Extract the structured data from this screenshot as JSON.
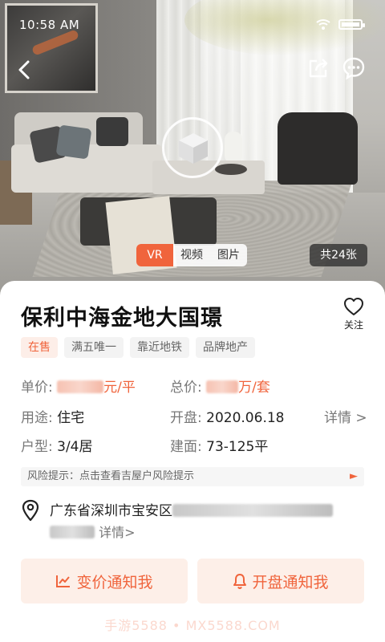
{
  "status_bar": {
    "time": "10:58 AM"
  },
  "media": {
    "tabs": [
      {
        "label": "VR",
        "active": true
      },
      {
        "label": "视频"
      },
      {
        "label": "图片"
      }
    ],
    "photo_count": "共24张"
  },
  "property": {
    "title": "保利中海金地大国璟",
    "follow_label": "关注",
    "tags": [
      {
        "label": "在售",
        "style": "hot"
      },
      {
        "label": "满五唯一"
      },
      {
        "label": "靠近地铁"
      },
      {
        "label": "品牌地产"
      }
    ],
    "unit_price": {
      "key": "单价:",
      "unit": "元/平"
    },
    "total_price": {
      "key": "总价:",
      "unit": "万/套"
    },
    "usage": {
      "key": "用途:",
      "value": "住宅"
    },
    "opening": {
      "key": "开盘:",
      "value": "2020.06.18"
    },
    "details_link": "详情 >",
    "layout": {
      "key": "户型:",
      "value": "3/4居"
    },
    "area": {
      "key": "建面:",
      "value": "73-125平"
    },
    "risk_notice": "风险提示：点击查看吉屋户风险提示",
    "address": {
      "prefix": "广东省深圳市宝安区",
      "details_link": "详情>"
    }
  },
  "actions": {
    "price_alert": "变价通知我",
    "opening_alert": "开盘通知我"
  },
  "watermark": "手游5588 • MX5588.COM",
  "colors": {
    "accent": "#f0643c",
    "accent_bg": "#fdefe8"
  }
}
